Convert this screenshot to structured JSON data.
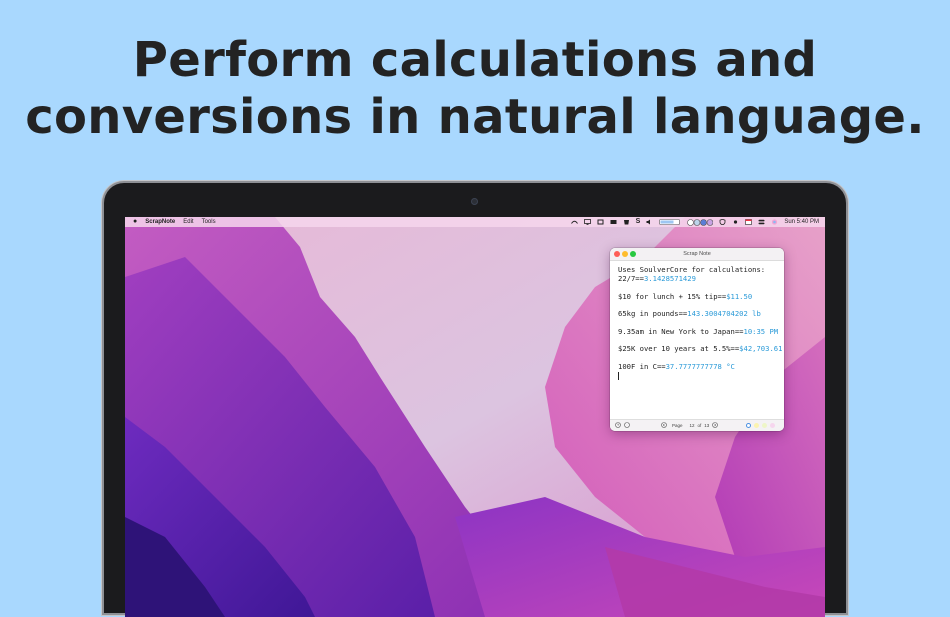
{
  "headline": {
    "line1": "Perform calculations and",
    "line2": "conversions in natural language."
  },
  "menubar": {
    "app_name": "ScrapNote",
    "menus": [
      "Edit",
      "Tools"
    ],
    "clock": "Sun 5:40 PM",
    "status_icons": [
      "cast-icon",
      "monitor-icon",
      "grid-icon",
      "keyboard-icon",
      "trash-icon",
      "soulver-s-icon",
      "speaker-icon",
      "battery-icon",
      "color-wheels-icon",
      "shield-icon",
      "dot-icon",
      "calendar-icon",
      "control-center-icon",
      "siri-icon"
    ]
  },
  "window": {
    "title": "Scrap Note",
    "lines": [
      {
        "expr": "Uses SoulverCore for calculations:",
        "result": ""
      },
      {
        "expr": "22/7==",
        "result": "3.1428571429"
      },
      {
        "expr": "$10 for lunch + 15% tip==",
        "result": "$11.50"
      },
      {
        "expr": "65kg in pounds==",
        "result": "143.3004704202 lb"
      },
      {
        "expr": "9.35am in New York to Japan==",
        "result": "10:35 PM"
      },
      {
        "expr": "$25K over 10 years at 5.5%==",
        "result": "$42,703.61"
      },
      {
        "expr": "100F in C==",
        "result": "37.7777777778 °C"
      }
    ],
    "status": {
      "page_label": "Page",
      "page_current": "12",
      "page_of": "of",
      "page_total": "13",
      "color_dots": [
        "#4a90e2",
        "#fbf3b0",
        "#eef6c8",
        "#f6d6ee"
      ]
    }
  },
  "colors": {
    "background": "#a9d8fe",
    "result_text": "#2a9ad8"
  }
}
